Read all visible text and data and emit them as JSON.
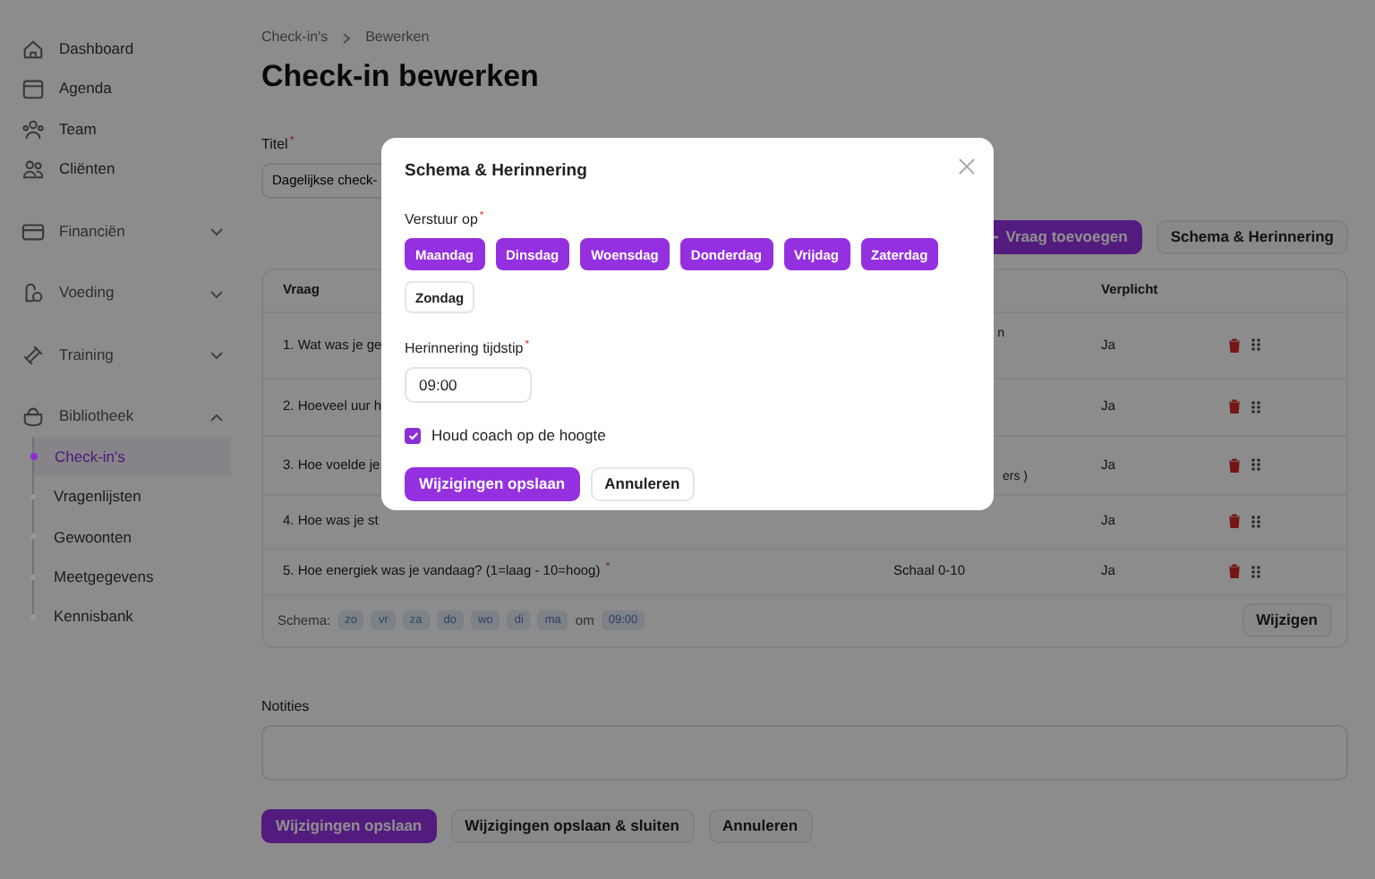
{
  "sidebar": {
    "items": [
      {
        "label": "Dashboard",
        "kind": "link"
      },
      {
        "label": "Agenda",
        "kind": "link"
      },
      {
        "label": "Team",
        "kind": "link"
      },
      {
        "label": "Cliënten",
        "kind": "link"
      },
      {
        "label": "Financiën",
        "kind": "group",
        "expanded": false
      },
      {
        "label": "Voeding",
        "kind": "group",
        "expanded": false
      },
      {
        "label": "Training",
        "kind": "group",
        "expanded": false
      },
      {
        "label": "Bibliotheek",
        "kind": "group",
        "expanded": true,
        "children": [
          {
            "label": "Check-in's",
            "selected": true
          },
          {
            "label": "Vragenlijsten",
            "selected": false
          },
          {
            "label": "Gewoonten",
            "selected": false
          },
          {
            "label": "Meetgegevens",
            "selected": false
          },
          {
            "label": "Kennisbank",
            "selected": false
          }
        ]
      }
    ]
  },
  "breadcrumb": [
    "Check-in's",
    "Bewerken"
  ],
  "page_title": "Check-in bewerken",
  "title_field": {
    "label": "Titel",
    "asterisk": "*",
    "value": "Dagelijkse check-"
  },
  "toolbar": [
    {
      "label": "Vraag toevoegen",
      "kind": "primary"
    },
    {
      "label": "Schema & Herinnering",
      "kind": "secondary"
    }
  ],
  "table": {
    "header": {
      "question": "Vraag",
      "required": "Verplicht"
    },
    "rows": [
      {
        "question": "1. Wat was je ge",
        "column_2": "n",
        "required": "Ja"
      },
      {
        "question": "2. Hoeveel uur h",
        "required": "Ja"
      },
      {
        "question": "3. Hoe voelde je",
        "column_2": "ers )",
        "required": "Ja"
      },
      {
        "question": "4. Hoe was je st",
        "required": "Ja"
      },
      {
        "question": "5. Hoe energiek was je vandaag? (1=laag - 10=hoog)",
        "asterisk": "*",
        "column_2": "Schaal 0-10",
        "required": "Ja"
      }
    ],
    "schedule": {
      "label": "Schema:",
      "days": [
        "zo",
        "vr",
        "za",
        "do",
        "wo",
        "di",
        "ma"
      ],
      "connector": "om",
      "time": "09:00",
      "button": "Wijzigen"
    }
  },
  "notes": {
    "label": "Notities"
  },
  "footer_buttons": [
    {
      "label": "Wijzigingen opslaan",
      "kind": "primary"
    },
    {
      "label": "Wijzigingen opslaan & sluiten",
      "kind": "secondary"
    },
    {
      "label": "Annuleren",
      "kind": "secondary"
    }
  ],
  "modal": {
    "title": "Schema & Herinnering",
    "days_label": "Verstuur op",
    "asterisk": "*",
    "days": [
      {
        "label": "Maandag",
        "selected": true
      },
      {
        "label": "Dinsdag",
        "selected": true
      },
      {
        "label": "Woensdag",
        "selected": true
      },
      {
        "label": "Donderdag",
        "selected": true
      },
      {
        "label": "Vrijdag",
        "selected": true
      },
      {
        "label": "Zaterdag",
        "selected": true
      },
      {
        "label": "Zondag",
        "selected": false
      }
    ],
    "time_label": "Herinnering tijdstip",
    "time_asterisk": "*",
    "time_value": "09:00",
    "notify": {
      "label": "Houd coach op de hoogte",
      "checked": true
    },
    "buttons": [
      {
        "label": "Wijzigingen opslaan",
        "kind": "primary"
      },
      {
        "label": "Annuleren",
        "kind": "secondary"
      }
    ]
  }
}
